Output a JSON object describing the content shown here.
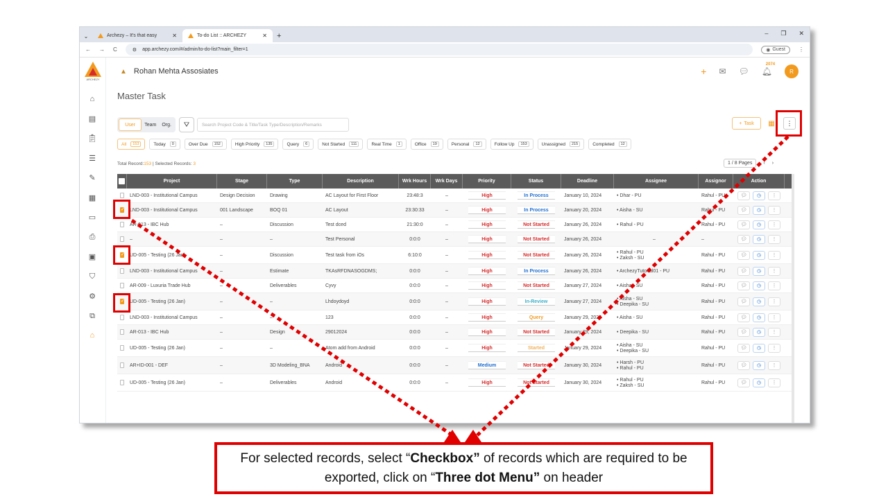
{
  "browser": {
    "tabs": [
      {
        "title": "Archezy – It's that easy",
        "active": false
      },
      {
        "title": "To-do List :: ARCHEZY",
        "active": true
      }
    ],
    "url": "app.archezy.com/#/admin/to-do-list?main_filter=1",
    "guest_label": "Guest"
  },
  "app": {
    "brand_text": "ARCHEZY",
    "company": "Rohan Mehta Assosiates",
    "notification_count": "2074",
    "avatar_initial": "R",
    "page_title": "Master Task",
    "toggle": {
      "user": "User",
      "team": "Team",
      "org": "Org."
    },
    "search_placeholder": "Search Project Code & Title/Task Type/Description/Remarks",
    "add_task_label": "Task",
    "chips": [
      {
        "label": "All",
        "count": "153",
        "active": true
      },
      {
        "label": "Today",
        "count": "0"
      },
      {
        "label": "Over Due",
        "count": "152"
      },
      {
        "label": "High Priority",
        "count": "135"
      },
      {
        "label": "Query",
        "count": "6"
      },
      {
        "label": "Not Started",
        "count": "111"
      },
      {
        "label": "Real Time",
        "count": "1"
      },
      {
        "label": "Office",
        "count": "19"
      },
      {
        "label": "Personal",
        "count": "12"
      },
      {
        "label": "Follow Up",
        "count": "153"
      },
      {
        "label": "Unassigned",
        "count": "215"
      },
      {
        "label": "Completed",
        "count": "12"
      }
    ],
    "total_label": "Total Record:",
    "total_value": "153",
    "selected_label": " | Selected Records: ",
    "selected_value": "3",
    "pager": "1 / 8 Pages"
  },
  "table": {
    "headers": [
      "Project",
      "Stage",
      "Type",
      "Description",
      "Wrk Hours",
      "Wrk Days",
      "Priority",
      "Status",
      "Deadline",
      "Assignee",
      "Assignor",
      "Action"
    ],
    "rows": [
      {
        "checked": false,
        "project": "LND-003 - Institutional Campus",
        "stage": "Design Decision",
        "type": "Drawing",
        "desc": "AC Layout for First Floor",
        "hours": "23:48:3",
        "days": "–",
        "priority": "High",
        "status": "In Process",
        "deadline": "January 10, 2024",
        "assignees": [
          "Dhar - PU"
        ],
        "assignor": "Rahul - PU"
      },
      {
        "checked": true,
        "project": "LND-003 - Institutional Campus",
        "stage": "001 Landscape",
        "type": "BOQ 01",
        "desc": "AC Layout",
        "hours": "23:30:33",
        "days": "–",
        "priority": "High",
        "status": "In Process",
        "deadline": "January 20, 2024",
        "assignees": [
          "Aisha - SU"
        ],
        "assignor": "Rahul - PU"
      },
      {
        "checked": false,
        "project": "AR-013 - IBC Hub",
        "stage": "–",
        "type": "Discussion",
        "desc": "Test dced",
        "hours": "21:30:0",
        "days": "–",
        "priority": "High",
        "status": "Not Started",
        "deadline": "January 26, 2024",
        "assignees": [
          "Rahul - PU"
        ],
        "assignor": "Rahul - PU"
      },
      {
        "checked": false,
        "project": "–",
        "stage": "–",
        "type": "–",
        "desc": "Test Personal",
        "hours": "0:0:0",
        "days": "–",
        "priority": "High",
        "status": "Not Started",
        "deadline": "January 26, 2024",
        "assignees": [
          "–"
        ],
        "assignor": "–"
      },
      {
        "checked": true,
        "project": "UD-005 - Testing (26 Jan)",
        "stage": "–",
        "type": "Discussion",
        "desc": "Test task from iOs",
        "hours": "6:10:0",
        "days": "–",
        "priority": "High",
        "status": "Not Started",
        "deadline": "January 26, 2024",
        "assignees": [
          "Rahul - PU",
          "Zaksh - SU"
        ],
        "assignor": "Rahul - PU"
      },
      {
        "checked": false,
        "project": "LND-003 - Institutional Campus",
        "stage": "–",
        "type": "Estimate",
        "desc": "TKAsRFDNASOGDMS;",
        "hours": "0:0:0",
        "days": "–",
        "priority": "High",
        "status": "In Process",
        "deadline": "January 26, 2024",
        "assignees": [
          "ArchezyTutorial01 - PU"
        ],
        "assignor": "Rahul - PU"
      },
      {
        "checked": false,
        "project": "AR-009 - Luxuria Trade Hub",
        "stage": "–",
        "type": "Deliverables",
        "desc": "Cyvy",
        "hours": "0:0:0",
        "days": "–",
        "priority": "High",
        "status": "Not Started",
        "deadline": "January 27, 2024",
        "assignees": [
          "Aisha - SU"
        ],
        "assignor": "Rahul - PU"
      },
      {
        "checked": true,
        "project": "UD-005 - Testing (26 Jan)",
        "stage": "–",
        "type": "–",
        "desc": "Lhdoydoyd",
        "hours": "0:0:0",
        "days": "–",
        "priority": "High",
        "status": "In-Review",
        "deadline": "January 27, 2024",
        "assignees": [
          "Aisha - SU",
          "Deepika - SU"
        ],
        "assignor": "Rahul - PU"
      },
      {
        "checked": false,
        "project": "LND-003 - Institutional Campus",
        "stage": "–",
        "type": "–",
        "desc": "123",
        "hours": "0:0:0",
        "days": "–",
        "priority": "High",
        "status": "Query",
        "deadline": "January 29, 2024",
        "assignees": [
          "Aisha - SU"
        ],
        "assignor": "Rahul - PU"
      },
      {
        "checked": false,
        "project": "AR-013 - IBC Hub",
        "stage": "–",
        "type": "Design",
        "desc": "29012024",
        "hours": "0:0:0",
        "days": "–",
        "priority": "High",
        "status": "Not Started",
        "deadline": "January 29, 2024",
        "assignees": [
          "Deepika - SU"
        ],
        "assignor": "Rahul - PU"
      },
      {
        "checked": false,
        "project": "UD-005 - Testing (26 Jan)",
        "stage": "–",
        "type": "–",
        "desc": "Atom add from Android",
        "hours": "0:0:0",
        "days": "–",
        "priority": "High",
        "status": "Started",
        "deadline": "January 29, 2024",
        "assignees": [
          "Aisha - SU",
          "Deepika - SU"
        ],
        "assignor": "Rahul - PU"
      },
      {
        "checked": false,
        "project": "AR+ID-001 - DEF",
        "stage": "–",
        "type": "3D Modeling_BNA",
        "desc": "Android",
        "hours": "0:0:0",
        "days": "–",
        "priority": "Medium",
        "status": "Not Started",
        "deadline": "January 30, 2024",
        "assignees": [
          "Harsh - PU",
          "Rahul - PU"
        ],
        "assignor": "Rahul - PU"
      },
      {
        "checked": false,
        "project": "UD-005 - Testing (26 Jan)",
        "stage": "–",
        "type": "Deliverables",
        "desc": "Android",
        "hours": "0:0:0",
        "days": "–",
        "priority": "High",
        "status": "Not Started",
        "deadline": "January 30, 2024",
        "assignees": [
          "Rahul - PU",
          "Zaksh - SU"
        ],
        "assignor": "Rahul - PU"
      }
    ]
  },
  "colors": {
    "accent": "#f29a1e",
    "priority_high": "#d62b2b",
    "priority_medium": "#1f6fd0",
    "status_in_process": "#1f6fd0",
    "status_not_started": "#d62b2b",
    "status_in_review": "#3bb0c9",
    "status_query": "#f29a1e",
    "status_started": "#f2b25e",
    "annotation": "#e00000"
  },
  "callout": {
    "part1": "For selected records, select “",
    "bold1": "Checkbox”",
    "part2": " of records which are required to be exported, click on “",
    "bold2": "Three dot Menu”",
    "part3": " on header"
  }
}
